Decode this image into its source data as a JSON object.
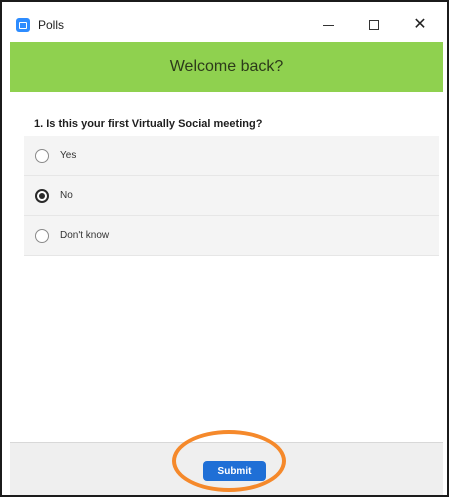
{
  "window": {
    "title": "Polls",
    "controls": {
      "minimize_icon": "minimize-icon",
      "maximize_icon": "maximize-icon",
      "close_icon": "close-icon"
    }
  },
  "banner": {
    "title": "Welcome back?",
    "color": "#8fd14f"
  },
  "poll": {
    "question": "1. Is this your first Virtually Social meeting?",
    "options": [
      {
        "label": "Yes",
        "selected": false
      },
      {
        "label": "No",
        "selected": true
      },
      {
        "label": "Don't know",
        "selected": false
      }
    ]
  },
  "footer": {
    "submit_label": "Submit",
    "submit_color": "#1f6fd6",
    "highlight_color": "#f5892b"
  }
}
